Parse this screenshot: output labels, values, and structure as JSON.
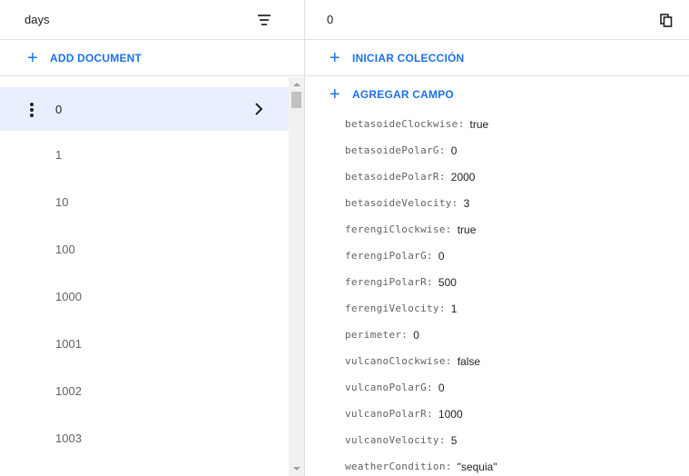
{
  "left": {
    "collection_title": "days",
    "add_document_label": "ADD DOCUMENT",
    "documents": [
      "0",
      "1",
      "10",
      "100",
      "1000",
      "1001",
      "1002",
      "1003"
    ],
    "selected_index": 0
  },
  "right": {
    "document_title": "0",
    "start_collection_label": "INICIAR COLECCIÓN",
    "add_field_label": "AGREGAR CAMPO",
    "fields": [
      {
        "key": "betasoideClockwise:",
        "value": "true"
      },
      {
        "key": "betasoidePolarG:",
        "value": "0"
      },
      {
        "key": "betasoidePolarR:",
        "value": "2000"
      },
      {
        "key": "betasoideVelocity:",
        "value": "3"
      },
      {
        "key": "ferengiClockwise:",
        "value": "true"
      },
      {
        "key": "ferengiPolarG:",
        "value": "0"
      },
      {
        "key": "ferengiPolarR:",
        "value": "500"
      },
      {
        "key": "ferengiVelocity:",
        "value": "1"
      },
      {
        "key": "perimeter:",
        "value": "0"
      },
      {
        "key": "vulcanoClockwise:",
        "value": "false"
      },
      {
        "key": "vulcanoPolarG:",
        "value": "0"
      },
      {
        "key": "vulcanoPolarR:",
        "value": "1000"
      },
      {
        "key": "vulcanoVelocity:",
        "value": "5"
      },
      {
        "key": "weatherCondition:",
        "value": "\"sequia\""
      }
    ]
  },
  "icons": {
    "plus": "+",
    "filter": "filter-icon",
    "copy": "copy-icon",
    "more": "more-vert-icon",
    "chevron": "chevron-right-icon"
  },
  "colors": {
    "accent": "#1a73e8",
    "selected_bg": "#e8f0fe",
    "divider": "#e0e0e0"
  }
}
